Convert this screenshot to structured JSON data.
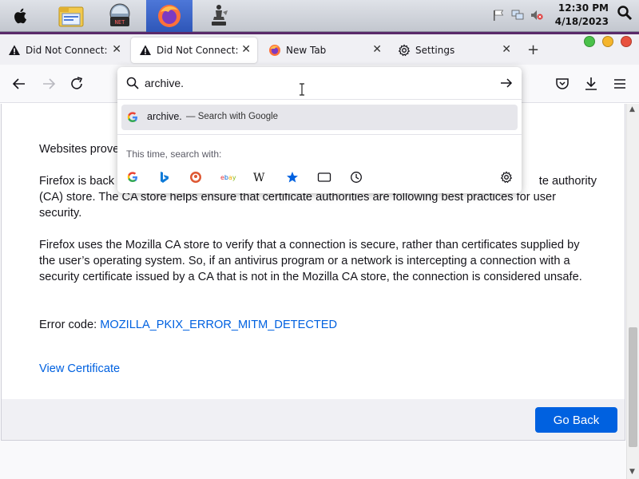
{
  "os": {
    "time": "12:30 PM",
    "date": "4/18/2023",
    "dock": [
      "apple-menu",
      "file-explorer",
      "system-monitor",
      "firefox",
      "chess"
    ]
  },
  "tabs": [
    {
      "label": "Did Not Connect: Po",
      "icon": "warning-icon",
      "active": false
    },
    {
      "label": "Did Not Connect: Po",
      "icon": "warning-icon",
      "active": true
    },
    {
      "label": "New Tab",
      "icon": "firefox-icon",
      "active": false
    },
    {
      "label": "Settings",
      "icon": "gear-icon",
      "active": false
    }
  ],
  "newtab_label": "+",
  "url": {
    "value": "archive.",
    "suggestion_term": "archive.",
    "suggestion_action": "— Search with Google",
    "this_time_label": "This time, search with:",
    "engines": [
      "Google",
      "Bing",
      "DuckDuckGo",
      "eBay",
      "Wikipedia",
      "Bookmarks",
      "Tabs",
      "History"
    ]
  },
  "content": {
    "p1": "Websites prove",
    "p2": "Firefox is back",
    "p2_tail": "te authority",
    "p2_cont": "(CA) store. The CA store helps ensure that certificate authorities are following best practices for user security.",
    "p3": "Firefox uses the Mozilla CA store to verify that a connection is secure, rather than certificates supplied by the user’s operating system. So, if an antivirus program or a network is intercepting a connection with a security certificate issued by a CA that is not in the Mozilla CA store, the connection is considered unsafe.",
    "error_label": "Error code: ",
    "error_code": "MOZILLA_PKIX_ERROR_MITM_DETECTED",
    "view_cert": "View Certificate",
    "go_back": "Go Back"
  },
  "colors": {
    "accent": "#0061e0",
    "dock_active": "#3a62c4"
  }
}
